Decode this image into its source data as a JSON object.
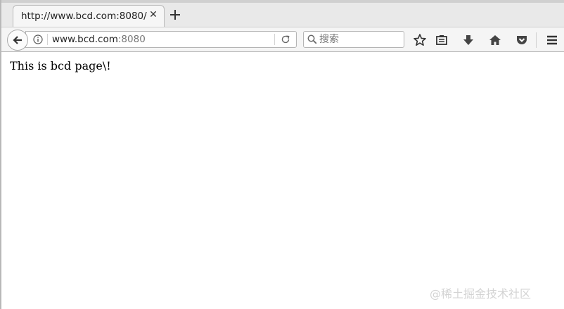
{
  "tab": {
    "title": "http://www.bcd.com:8080/",
    "close_glyph": "✕"
  },
  "newtab": {
    "icon": "plus-icon"
  },
  "navbar": {
    "url_host": "www.bcd.com",
    "url_port": ":8080",
    "search_placeholder": "搜索",
    "icons": [
      "back-arrow-icon",
      "info-icon",
      "reload-icon",
      "search-icon",
      "star-icon",
      "reading-list-icon",
      "download-icon",
      "home-icon",
      "pocket-icon",
      "hamburger-menu-icon"
    ]
  },
  "page": {
    "text": "This is bcd page\\!"
  },
  "watermark": "@稀土掘金技术社区",
  "colors": {
    "chrome_bg": "#f5f5f5",
    "tabstrip_bg": "#e9e9e9",
    "icon_color": "#444444",
    "watermark": "#d3d3d3"
  }
}
